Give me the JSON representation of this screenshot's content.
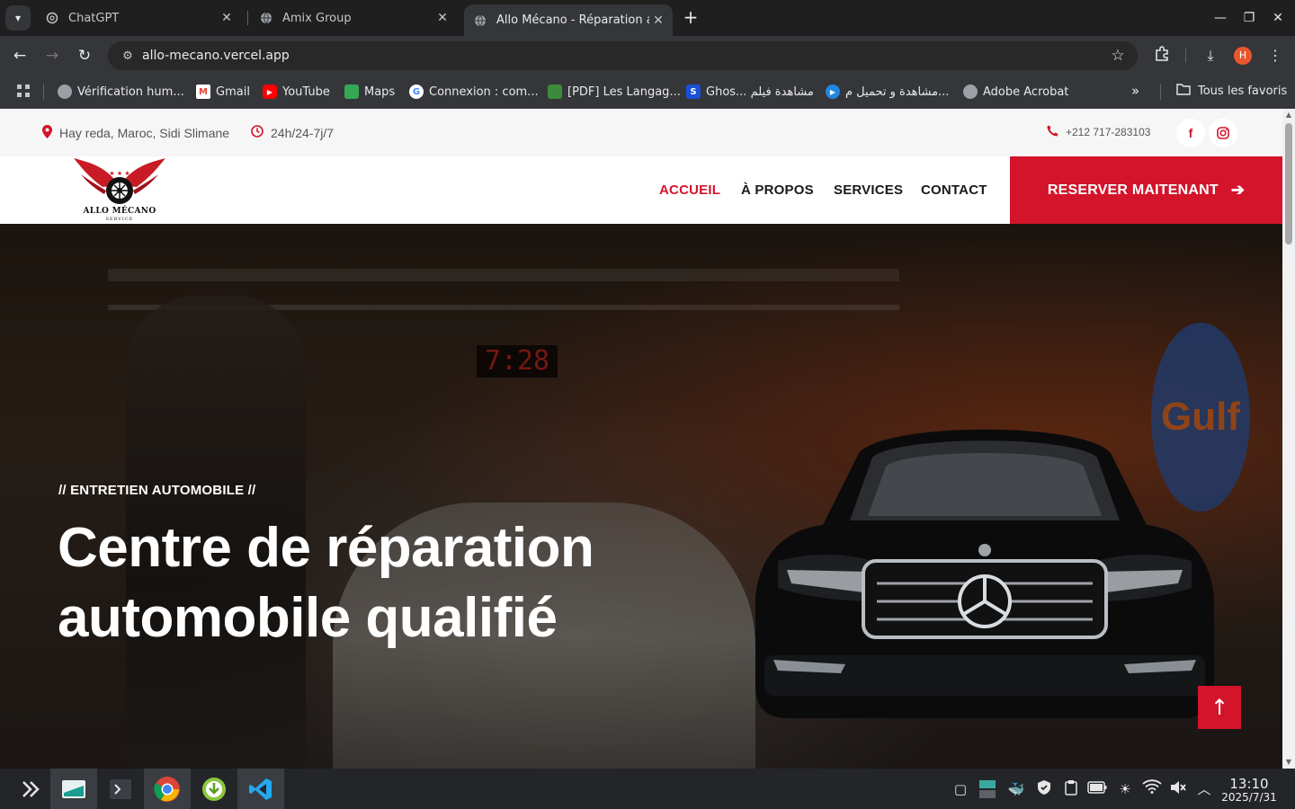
{
  "browser": {
    "tabs": [
      {
        "title": "ChatGPT",
        "icon": "chatgpt-icon",
        "active": false
      },
      {
        "title": "Amix Group",
        "icon": "globe-icon",
        "active": false
      },
      {
        "title": "Allo Mécano - Réparation a",
        "icon": "globe-icon",
        "active": true
      }
    ],
    "url": "allo-mecano.vercel.app",
    "avatar_letter": "H",
    "bookmarks": [
      {
        "label": "Vérification hum...",
        "icon": "globe-icon"
      },
      {
        "label": "Gmail",
        "icon": "gmail-icon"
      },
      {
        "label": "YouTube",
        "icon": "youtube-icon"
      },
      {
        "label": "Maps",
        "icon": "maps-icon"
      },
      {
        "label": "Connexion : com...",
        "icon": "google-icon"
      },
      {
        "label": "[PDF] Les Langag...",
        "icon": "pdf-icon"
      },
      {
        "label": "Ghos... مشاهدة فيلم",
        "icon": "s-icon"
      },
      {
        "label": "مشاهدة و تحميل م...",
        "icon": "play-icon"
      },
      {
        "label": "Adobe Acrobat",
        "icon": "globe-icon"
      }
    ],
    "all_bookmarks_label": "Tous les favoris"
  },
  "site": {
    "topbar": {
      "address": "Hay reda, Maroc, Sidi Slimane",
      "hours": "24h/24-7j/7",
      "phone": "+212 717-283103"
    },
    "logo": {
      "name": "ALLO MÉCANO",
      "tagline": "SERVICE"
    },
    "nav": {
      "items": [
        "ACCUEIL",
        "À PROPOS",
        "SERVICES",
        "CONTACT"
      ],
      "active": "ACCUEIL",
      "cta": "RESERVER MAITENANT"
    },
    "hero": {
      "kicker": "// ENTRETIEN AUTOMOBILE //",
      "title_line1": "Centre de réparation",
      "title_line2": "automobile qualifié",
      "clock_text": "7:28",
      "sign_text": "Gulf"
    }
  },
  "taskbar": {
    "time": "13:10",
    "date": "2025/7/31"
  },
  "colors": {
    "brand_red": "#d3142b",
    "chrome_dark": "#35363a",
    "taskbar": "#232529"
  }
}
